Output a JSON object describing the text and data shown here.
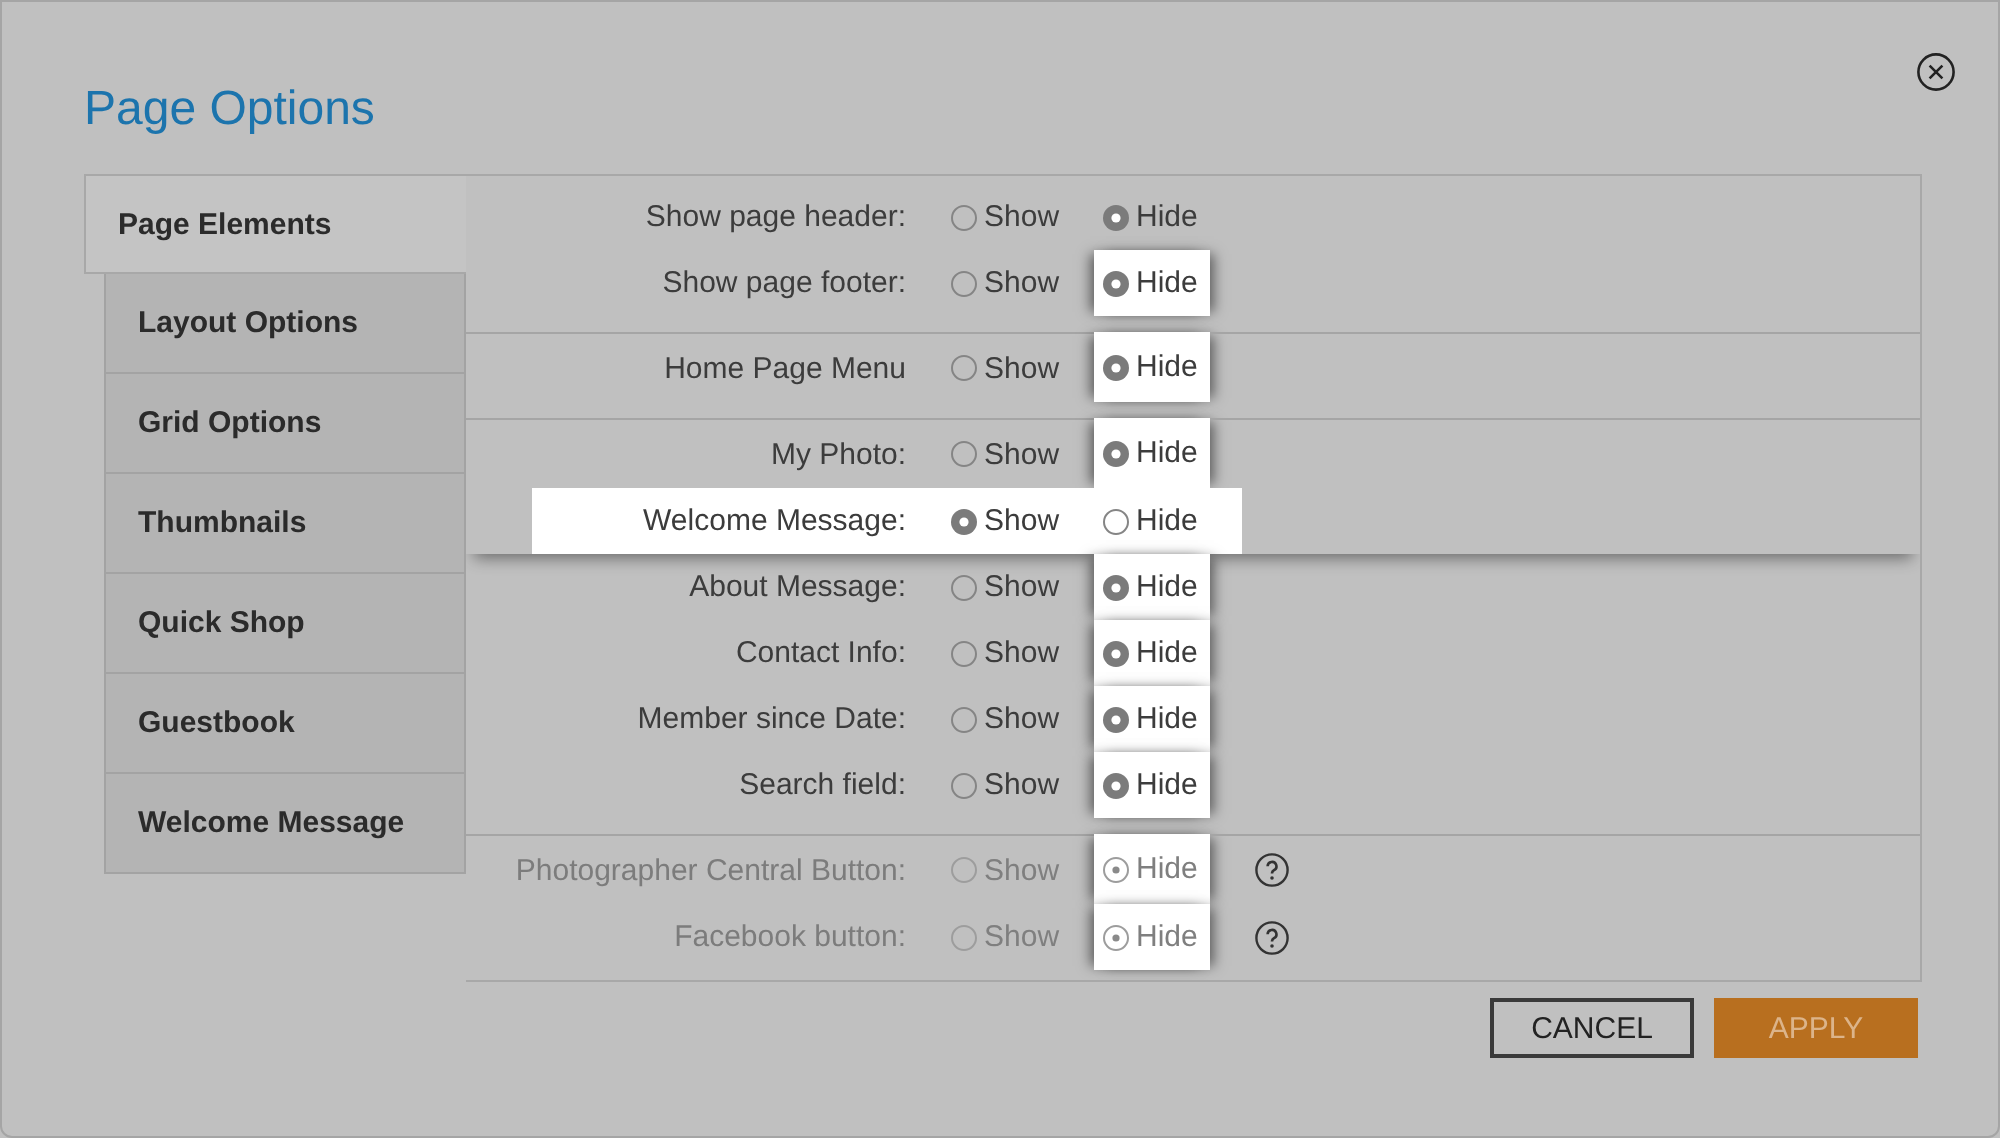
{
  "dialog": {
    "title": "Page Options"
  },
  "tabs": [
    {
      "label": "Page Elements",
      "selected": true
    },
    {
      "label": "Layout Options",
      "selected": false
    },
    {
      "label": "Grid Options",
      "selected": false
    },
    {
      "label": "Thumbnails",
      "selected": false
    },
    {
      "label": "Quick Shop",
      "selected": false
    },
    {
      "label": "Guestbook",
      "selected": false
    },
    {
      "label": "Welcome Message",
      "selected": false
    }
  ],
  "rows": [
    {
      "label": "Show page header:",
      "divider": false,
      "disabled": false,
      "help": false,
      "hide_spotlit": false,
      "row_spotlit": false,
      "options": [
        {
          "label": "Show",
          "selected": false
        },
        {
          "label": "Hide",
          "selected": true
        }
      ]
    },
    {
      "label": "Show page footer:",
      "divider": false,
      "disabled": false,
      "help": false,
      "hide_spotlit": true,
      "row_spotlit": false,
      "options": [
        {
          "label": "Show",
          "selected": false
        },
        {
          "label": "Hide",
          "selected": true
        }
      ]
    },
    {
      "label": "Home Page Menu",
      "divider": true,
      "disabled": false,
      "help": false,
      "hide_spotlit": true,
      "row_spotlit": false,
      "options": [
        {
          "label": "Show",
          "selected": false
        },
        {
          "label": "Hide",
          "selected": true
        }
      ]
    },
    {
      "label": "My Photo:",
      "divider": true,
      "disabled": false,
      "help": false,
      "hide_spotlit": true,
      "row_spotlit": false,
      "options": [
        {
          "label": "Show",
          "selected": false
        },
        {
          "label": "Hide",
          "selected": true
        }
      ]
    },
    {
      "label": "Welcome Message:",
      "divider": false,
      "disabled": false,
      "help": false,
      "hide_spotlit": false,
      "row_spotlit": true,
      "options": [
        {
          "label": "Show",
          "selected": true
        },
        {
          "label": "Hide",
          "selected": false
        }
      ]
    },
    {
      "label": "About Message:",
      "divider": false,
      "disabled": false,
      "help": false,
      "hide_spotlit": true,
      "row_spotlit": false,
      "options": [
        {
          "label": "Show",
          "selected": false
        },
        {
          "label": "Hide",
          "selected": true
        }
      ]
    },
    {
      "label": "Contact Info:",
      "divider": false,
      "disabled": false,
      "help": false,
      "hide_spotlit": true,
      "row_spotlit": false,
      "options": [
        {
          "label": "Show",
          "selected": false
        },
        {
          "label": "Hide",
          "selected": true
        }
      ]
    },
    {
      "label": "Member since Date:",
      "divider": false,
      "disabled": false,
      "help": false,
      "hide_spotlit": true,
      "row_spotlit": false,
      "options": [
        {
          "label": "Show",
          "selected": false
        },
        {
          "label": "Hide",
          "selected": true
        }
      ]
    },
    {
      "label": "Search field:",
      "divider": false,
      "disabled": false,
      "help": false,
      "hide_spotlit": true,
      "row_spotlit": false,
      "options": [
        {
          "label": "Show",
          "selected": false
        },
        {
          "label": "Hide",
          "selected": true
        }
      ]
    },
    {
      "label": "Photographer Central Button:",
      "divider": true,
      "disabled": true,
      "help": true,
      "hide_spotlit": true,
      "row_spotlit": false,
      "options": [
        {
          "label": "Show",
          "selected": false
        },
        {
          "label": "Hide",
          "selected": true
        }
      ]
    },
    {
      "label": "Facebook button:",
      "divider": false,
      "disabled": true,
      "help": true,
      "hide_spotlit": true,
      "row_spotlit": false,
      "options": [
        {
          "label": "Show",
          "selected": false
        },
        {
          "label": "Hide",
          "selected": true
        }
      ]
    }
  ],
  "buttons": [
    {
      "label": "CANCEL",
      "kind": "secondary"
    },
    {
      "label": "APPLY",
      "kind": "primary"
    }
  ]
}
